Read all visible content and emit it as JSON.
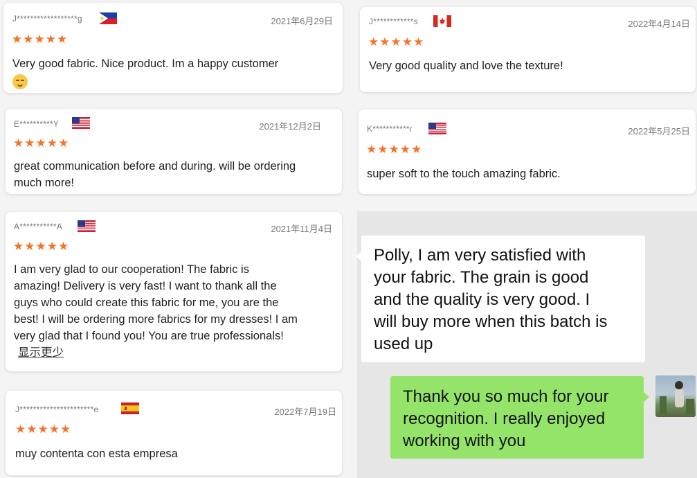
{
  "reviews": [
    {
      "user": "J******************g",
      "country": "Philippines",
      "date": "2021年6月29日",
      "stars": "★★★★★",
      "rating": 5,
      "text": "Very good fabric. Nice product. Im a happy customer"
    },
    {
      "user": "E**********Y",
      "country": "United States",
      "date": "2021年12月2日",
      "stars": "★★★★★",
      "rating": 5,
      "text_lines": [
        "great communication before and during. will be ordering",
        "much more!"
      ]
    },
    {
      "user": "A***********A",
      "country": "United States",
      "date": "2021年11月4日",
      "stars": "★★★★★",
      "rating": 5,
      "text_lines": [
        "I am very glad to our cooperation! The fabric is",
        "amazing! Delivery is very fast! I want to thank all the",
        "guys who could create this fabric for me, you are the",
        "best! I will be ordering more fabrics for my dresses! I am",
        "very glad that I found you! You are true professionals!"
      ],
      "show_less": "显示更少"
    },
    {
      "user": "J**********************e",
      "country": "Spain",
      "date": "2022年7月19日",
      "stars": "★★★★★",
      "rating": 5,
      "text": "muy contenta con esta empresa"
    },
    {
      "user": "J************s",
      "country": "Canada",
      "date": "2022年4月14日",
      "stars": "★★★★★",
      "rating": 5,
      "text": "Very good quality and love the texture!"
    },
    {
      "user": "K***********r",
      "country": "United States",
      "date": "2022年5月25日",
      "stars": "★★★★★",
      "rating": 5,
      "text": "super soft to the touch amazing fabric."
    }
  ],
  "chat": {
    "incoming_lines": [
      "Polly, I am very satisfied with",
      "your fabric. The grain is good",
      "and the quality is very good. I",
      "will buy more when this batch is",
      "used up"
    ],
    "outgoing_lines": [
      "Thank you so much for your",
      "recognition. I really enjoyed",
      "working with you"
    ]
  },
  "colors": {
    "star": "#f2742a",
    "chat_bg": "#e6e6e6",
    "outgoing_bubble": "#95e46a"
  }
}
